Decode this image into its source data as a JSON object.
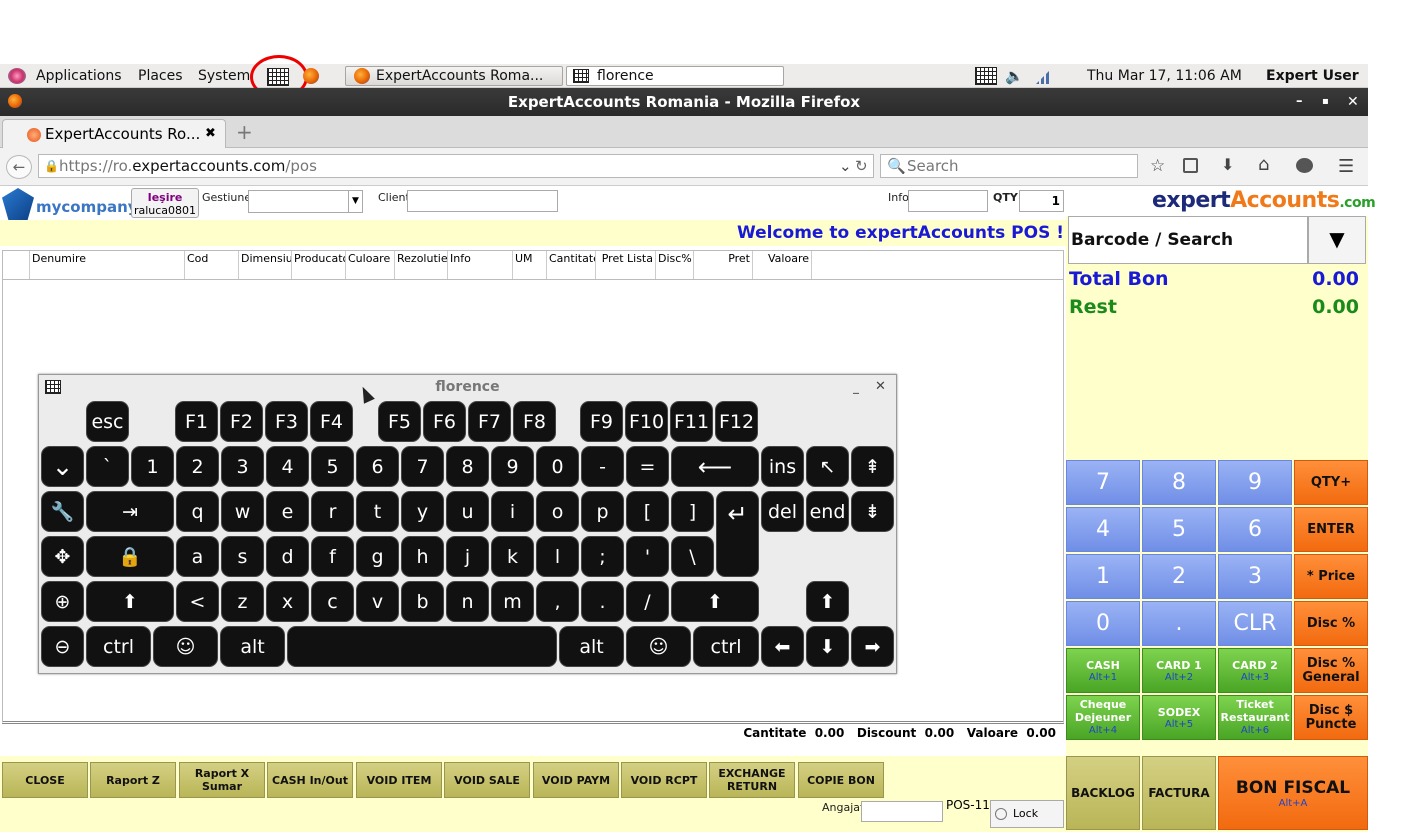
{
  "panel": {
    "menus": [
      "Applications",
      "Places",
      "System"
    ],
    "tasks": [
      "ExpertAccounts Roma...",
      "florence"
    ],
    "datetime": "Thu Mar 17, 11:06 AM",
    "user": "Expert User"
  },
  "window": {
    "title": "ExpertAccounts Romania - Mozilla Firefox"
  },
  "browser": {
    "tab_title": "ExpertAccounts Ro...",
    "url_prefix": "https://ro.",
    "url_domain": "expertaccounts.com",
    "url_path": "/pos",
    "search_placeholder": "Search"
  },
  "pos": {
    "company": "mycompany",
    "exit_label": "Ieşire",
    "exit_user": "raluca0801",
    "gestiune_label": "Gestiune",
    "client_label": "Client",
    "info_label": "Info",
    "qty_label": "QTY",
    "qty_value": "1",
    "brand_a": "expert",
    "brand_b": "Accounts",
    "brand_c": ".com",
    "welcome": "Welcome to expertAccounts POS !",
    "columns": [
      "Denumire",
      "Cod",
      "Dimensiun",
      "Producator",
      "Culoare",
      "Rezolutie",
      "Info",
      "UM",
      "Cantitate",
      "Pret Lista",
      "Disc%",
      "Pret",
      "Valoare"
    ],
    "totals": {
      "cant_label": "Cantitate",
      "cant": "0.00",
      "disc_label": "Discount",
      "disc": "0.00",
      "val_label": "Valoare",
      "val": "0.00"
    },
    "function_buttons": [
      "CLOSE",
      "Raport Z",
      "Raport X Sumar",
      "CASH In/Out",
      "VOID ITEM",
      "VOID SALE",
      "VOID PAYM",
      "VOID RCPT",
      "EXCHANGE RETURN",
      "COPIE BON"
    ],
    "angajat_label": "Angajat",
    "pos_id": "POS-11",
    "lock_label": "Lock POS",
    "barcode_placeholder": "Barcode / Search",
    "total_bon_label": "Total Bon",
    "total_bon": "0.00",
    "rest_label": "Rest",
    "rest": "0.00",
    "keypad": {
      "digits": [
        "7",
        "8",
        "9",
        "4",
        "5",
        "6",
        "1",
        "2",
        "3",
        "0",
        ".",
        "CLR"
      ],
      "right": [
        "QTY+",
        "ENTER",
        "* Price",
        "Disc %",
        "Disc % General",
        "Disc $ Puncte"
      ],
      "payments": [
        {
          "label": "CASH",
          "sub": "Alt+1"
        },
        {
          "label": "CARD 1",
          "sub": "Alt+2"
        },
        {
          "label": "CARD 2",
          "sub": "Alt+3"
        },
        {
          "label": "Cheque Dejeuner",
          "sub": "Alt+4"
        },
        {
          "label": "SODEX",
          "sub": "Alt+5"
        },
        {
          "label": "Ticket Restaurant",
          "sub": "Alt+6"
        }
      ],
      "backlog": "BACKLOG",
      "factura": "FACTURA",
      "bon_fiscal": "BON FISCAL",
      "bon_fiscal_sub": "Alt+A"
    }
  },
  "keyboard": {
    "title": "florence",
    "row0": [
      "esc",
      "F1",
      "F2",
      "F3",
      "F4",
      "F5",
      "F6",
      "F7",
      "F8",
      "F9",
      "F10",
      "F11",
      "F12"
    ],
    "row1": [
      "`",
      "1",
      "2",
      "3",
      "4",
      "5",
      "6",
      "7",
      "8",
      "9",
      "0",
      "-",
      "="
    ],
    "row1_extra": [
      "ins"
    ],
    "row2": [
      "q",
      "w",
      "e",
      "r",
      "t",
      "y",
      "u",
      "i",
      "o",
      "p",
      "[",
      "]"
    ],
    "row2_extra": [
      "del",
      "end"
    ],
    "row3": [
      "a",
      "s",
      "d",
      "f",
      "g",
      "h",
      "j",
      "k",
      "l",
      ";",
      "'",
      "\\"
    ],
    "row4": [
      "<",
      "z",
      "x",
      "c",
      "v",
      "b",
      "n",
      "m",
      ",",
      ".",
      "/"
    ],
    "row5_ctrl": "ctrl",
    "row5_alt": "alt",
    "row5_alt2": "alt",
    "row5_ctrl2": "ctrl"
  }
}
